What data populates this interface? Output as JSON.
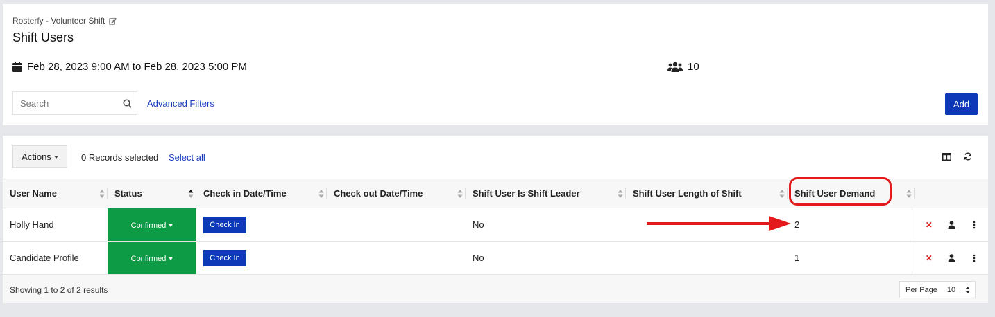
{
  "header": {
    "breadcrumb": "Rosterfy - Volunteer Shift",
    "title": "Shift Users",
    "date_range": "Feb 28, 2023 9:00 AM to Feb 28, 2023 5:00 PM",
    "user_count": "10",
    "search_placeholder": "Search",
    "advanced_filters": "Advanced Filters",
    "add_label": "Add"
  },
  "toolbar": {
    "actions_label": "Actions",
    "records_selected": "0 Records selected",
    "select_all": "Select all"
  },
  "table": {
    "columns": [
      "User Name",
      "Status",
      "Check in Date/Time",
      "Check out Date/Time",
      "Shift User Is Shift Leader",
      "Shift User Length of Shift",
      "Shift User Demand"
    ],
    "rows": [
      {
        "name": "Holly Hand",
        "status": "Confirmed",
        "checkin": "Check In",
        "leader": "No",
        "demand": "2"
      },
      {
        "name": "Candidate Profile",
        "status": "Confirmed",
        "checkin": "Check In",
        "leader": "No",
        "demand": "1"
      }
    ]
  },
  "footer": {
    "showing": "Showing 1 to 2 of 2 results",
    "per_page_label": "Per Page",
    "per_page_value": "10"
  },
  "colors": {
    "primary": "#0d39b8",
    "confirmed": "#0d9b45",
    "annotation": "#e3191b",
    "link": "#1a3fbf"
  },
  "icons": [
    "edit-icon",
    "calendar-icon",
    "users-icon",
    "search-icon",
    "columns-icon",
    "refresh-icon",
    "delete-icon",
    "user-icon",
    "more-vertical-icon"
  ]
}
